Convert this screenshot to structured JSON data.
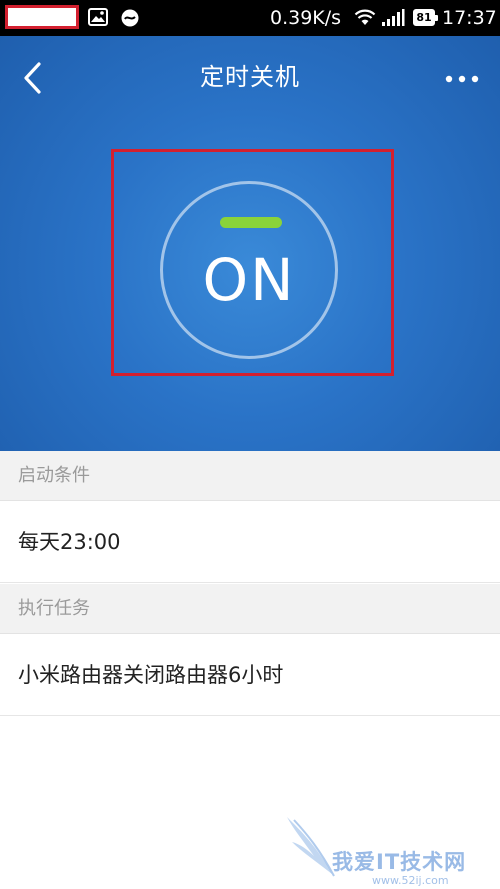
{
  "status_bar": {
    "speed": "0.39K/s",
    "battery": "81",
    "time": "17:37",
    "icons": [
      "gallery-icon",
      "chat-icon",
      "wifi-icon",
      "signal-icon",
      "battery-icon"
    ]
  },
  "header": {
    "title": "定时关机",
    "back_icon": "chevron-left-icon",
    "more_icon": "more-dots-icon"
  },
  "toggle": {
    "label": "ON",
    "state": "on",
    "indicator_color": "#8ad33a"
  },
  "sections": [
    {
      "header": "启动条件",
      "value": "每天23:00"
    },
    {
      "header": "执行任务",
      "value": "小米路由器关闭路由器6小时"
    }
  ],
  "watermark": {
    "text": "我爱IT技术网",
    "sub": "www.52ij.com"
  },
  "colors": {
    "header_blue": "#2a73c7",
    "highlight_red": "#d3202f",
    "section_bg": "#f2f2f2"
  }
}
